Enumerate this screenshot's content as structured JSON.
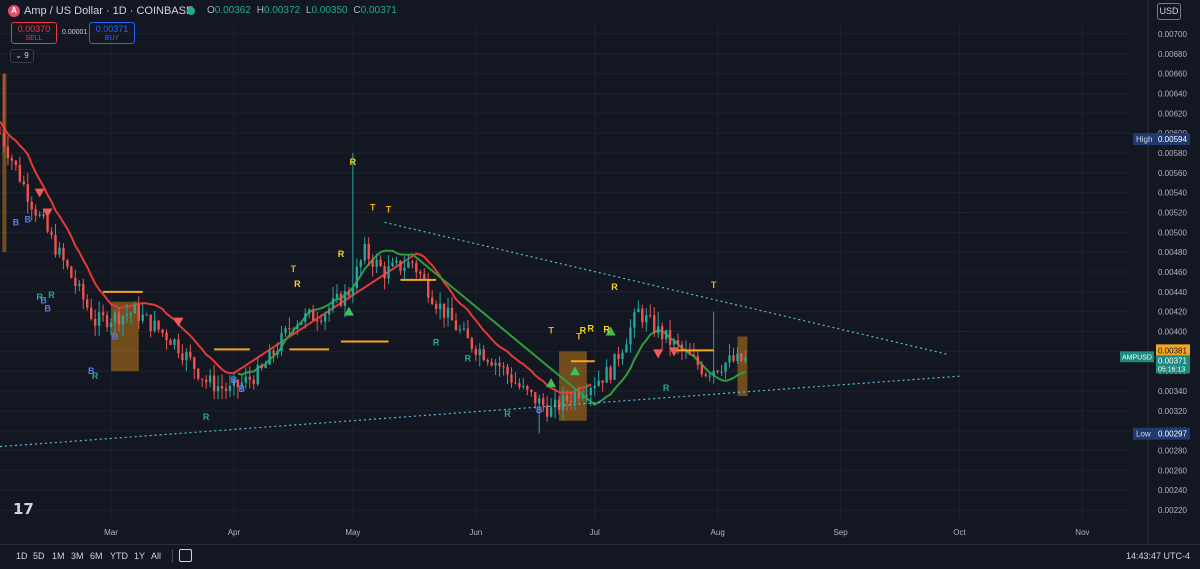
{
  "header": {
    "logo_letter": "A",
    "symbol_title": "Amp / US Dollar · 1D · COINBASE",
    "ohlc": {
      "o_label": "O",
      "o": "0.00362",
      "h_label": "H",
      "h": "0.00372",
      "l_label": "L",
      "l": "0.00350",
      "c_label": "C",
      "c": "0.00371"
    },
    "currency": "USD"
  },
  "trade": {
    "sell_price": "0.00370",
    "sell_label": "SELL",
    "buy_price": "0.00371",
    "buy_label": "BUY",
    "spread": "0.00001"
  },
  "indicators_toggle": "9",
  "timeframes": [
    "1D",
    "5D",
    "1M",
    "3M",
    "6M",
    "YTD",
    "1Y",
    "All"
  ],
  "clock": "14:43:47 UTC-4",
  "brand_mark": "17",
  "chart_data": {
    "type": "candlestick",
    "symbol": "AMPUSD",
    "price_axis": {
      "min": 0.0021,
      "max": 0.0071,
      "ticks": [
        "0.00700",
        "0.00680",
        "0.00660",
        "0.00640",
        "0.00620",
        "0.00600",
        "0.00580",
        "0.00560",
        "0.00540",
        "0.00520",
        "0.00500",
        "0.00480",
        "0.00460",
        "0.00440",
        "0.00420",
        "0.00400",
        "0.00380",
        "0.00360",
        "0.00340",
        "0.00320",
        "0.00300",
        "0.00280",
        "0.00260",
        "0.00240",
        "0.00220"
      ]
    },
    "time_axis": [
      {
        "label": "Mar",
        "day": 28
      },
      {
        "label": "Apr",
        "day": 59
      },
      {
        "label": "May",
        "day": 89
      },
      {
        "label": "Jun",
        "day": 120
      },
      {
        "label": "Jul",
        "day": 150
      },
      {
        "label": "Aug",
        "day": 181
      },
      {
        "label": "Sep",
        "day": 212
      },
      {
        "label": "Oct",
        "day": 242
      },
      {
        "label": "Nov",
        "day": 273
      }
    ],
    "time_range_days": [
      0,
      285
    ],
    "candle_last_day": 188,
    "markers": {
      "high": {
        "label": "High",
        "value": "0.00594"
      },
      "low": {
        "label": "Low",
        "value": "0.00297"
      },
      "last": {
        "label": "AMPUSD",
        "value": "0.00371",
        "countdown": "05:16:13"
      },
      "level": {
        "value": "0.00381"
      }
    },
    "key_closes": [
      {
        "day": 0,
        "c": 0.006
      },
      {
        "day": 8,
        "c": 0.0053
      },
      {
        "day": 16,
        "c": 0.0047
      },
      {
        "day": 24,
        "c": 0.0041
      },
      {
        "day": 34,
        "c": 0.0042
      },
      {
        "day": 44,
        "c": 0.0039
      },
      {
        "day": 52,
        "c": 0.0035
      },
      {
        "day": 58,
        "c": 0.0034
      },
      {
        "day": 66,
        "c": 0.0036
      },
      {
        "day": 74,
        "c": 0.0041
      },
      {
        "day": 82,
        "c": 0.0042
      },
      {
        "day": 88,
        "c": 0.0044
      },
      {
        "day": 92,
        "c": 0.0048
      },
      {
        "day": 97,
        "c": 0.0046
      },
      {
        "day": 104,
        "c": 0.0047
      },
      {
        "day": 110,
        "c": 0.0043
      },
      {
        "day": 118,
        "c": 0.0039
      },
      {
        "day": 125,
        "c": 0.0037
      },
      {
        "day": 132,
        "c": 0.0034
      },
      {
        "day": 139,
        "c": 0.0032
      },
      {
        "day": 146,
        "c": 0.0034
      },
      {
        "day": 154,
        "c": 0.0036
      },
      {
        "day": 161,
        "c": 0.0042
      },
      {
        "day": 166,
        "c": 0.004
      },
      {
        "day": 172,
        "c": 0.0038
      },
      {
        "day": 178,
        "c": 0.0036
      },
      {
        "day": 184,
        "c": 0.0037
      },
      {
        "day": 188,
        "c": 0.00371
      }
    ],
    "trendlines": [
      {
        "name": "upper",
        "from": {
          "day": 97,
          "v": 0.0051
        },
        "to": {
          "day": 239,
          "v": 0.00377
        }
      },
      {
        "name": "lower",
        "from": {
          "day": 0,
          "v": 0.00284
        },
        "to": {
          "day": 242,
          "v": 0.00355
        }
      }
    ],
    "signal_labels": [
      {
        "t": "B",
        "day": 4,
        "v": 0.00507,
        "c": "#5b7cf0"
      },
      {
        "t": "B",
        "day": 7,
        "v": 0.0051,
        "c": "#5b7cf0"
      },
      {
        "t": "R",
        "day": 10,
        "v": 0.00432,
        "c": "#22ab94"
      },
      {
        "t": "R",
        "day": 13,
        "v": 0.00434,
        "c": "#22ab94"
      },
      {
        "t": "B",
        "day": 11,
        "v": 0.00428,
        "c": "#5b7cf0"
      },
      {
        "t": "B",
        "day": 12,
        "v": 0.0042,
        "c": "#5b7cf0"
      },
      {
        "t": "B",
        "day": 29,
        "v": 0.00392,
        "c": "#5b7cf0"
      },
      {
        "t": "B",
        "day": 23,
        "v": 0.00357,
        "c": "#5b7cf0"
      },
      {
        "t": "R",
        "day": 24,
        "v": 0.00352,
        "c": "#22ab94"
      },
      {
        "t": "R",
        "day": 52,
        "v": 0.00311,
        "c": "#22ab94"
      },
      {
        "t": "B",
        "day": 59,
        "v": 0.00348,
        "c": "#5b7cf0"
      },
      {
        "t": "B",
        "day": 61,
        "v": 0.00339,
        "c": "#5b7cf0"
      },
      {
        "t": "T",
        "day": 74,
        "v": 0.0046,
        "c": "#f5a623"
      },
      {
        "t": "R",
        "day": 75,
        "v": 0.00445,
        "c": "#f5d623"
      },
      {
        "t": "R",
        "day": 89,
        "v": 0.00568,
        "c": "#f5d623"
      },
      {
        "t": "T",
        "day": 94,
        "v": 0.00522,
        "c": "#f5a623"
      },
      {
        "t": "T",
        "day": 98,
        "v": 0.0052,
        "c": "#f5a623"
      },
      {
        "t": "R",
        "day": 86,
        "v": 0.00475,
        "c": "#f5d623"
      },
      {
        "t": "R",
        "day": 110,
        "v": 0.00386,
        "c": "#22ab94"
      },
      {
        "t": "R",
        "day": 118,
        "v": 0.0037,
        "c": "#22ab94"
      },
      {
        "t": "R",
        "day": 128,
        "v": 0.00314,
        "c": "#22ab94"
      },
      {
        "t": "B",
        "day": 136,
        "v": 0.00318,
        "c": "#5b7cf0"
      },
      {
        "t": "T",
        "day": 139,
        "v": 0.00398,
        "c": "#f5a623"
      },
      {
        "t": "T",
        "day": 146,
        "v": 0.00392,
        "c": "#f5a623"
      },
      {
        "t": "R",
        "day": 147,
        "v": 0.00398,
        "c": "#f5d623"
      },
      {
        "t": "R",
        "day": 149,
        "v": 0.004,
        "c": "#f5d623"
      },
      {
        "t": "R",
        "day": 155,
        "v": 0.00442,
        "c": "#f5d623"
      },
      {
        "t": "R",
        "day": 153,
        "v": 0.00399,
        "c": "#f5d623"
      },
      {
        "t": "T",
        "day": 180,
        "v": 0.00444,
        "c": "#f5a623"
      },
      {
        "t": "R",
        "day": 168,
        "v": 0.0034,
        "c": "#22ab94"
      }
    ],
    "up_arrows": [
      {
        "day": 88,
        "v": 0.0042
      },
      {
        "day": 139,
        "v": 0.00348
      },
      {
        "day": 145,
        "v": 0.0036
      },
      {
        "day": 154,
        "v": 0.004
      }
    ],
    "down_arrows": [
      {
        "day": 10,
        "v": 0.0054
      },
      {
        "day": 12,
        "v": 0.0052
      },
      {
        "day": 45,
        "v": 0.0041
      },
      {
        "day": 166,
        "v": 0.00378
      },
      {
        "day": 170,
        "v": 0.0038
      }
    ],
    "colors": {
      "up": "#26a69a",
      "down": "#ef5350",
      "ma_red": "#e53935",
      "ma_green": "#2e9e3b",
      "level": "#f5a623",
      "band": "#c07a1a",
      "trend": "#4fc3d7",
      "grid": "#1e222d"
    }
  }
}
